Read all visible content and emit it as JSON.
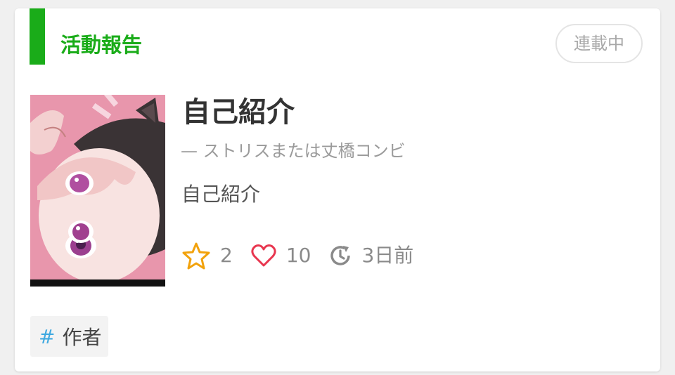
{
  "card": {
    "category": "活動報告",
    "status": "連載中",
    "title": "自己紹介",
    "author": "— ストリスまたは丈橋コンビ",
    "excerpt": "自己紹介",
    "thumbnail_icon": "anime-girl-cat-ear-hood-thumbnail",
    "stats": {
      "stars": "2",
      "likes": "10",
      "updated": "3日前"
    },
    "tag": {
      "hash": "#",
      "label": "作者"
    }
  },
  "colors": {
    "accent": "#1aac19",
    "star": "#f2a20c",
    "heart": "#e8364f",
    "tag_hash": "#3fa9e0",
    "muted_text": "#8a8a8a"
  }
}
